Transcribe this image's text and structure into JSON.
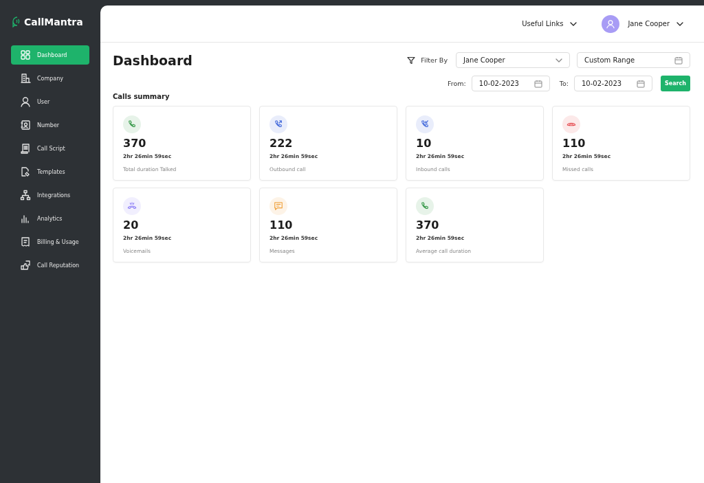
{
  "brand": {
    "name": "CallMantra"
  },
  "sidebar": {
    "items": [
      {
        "label": "Dashboard",
        "kind": "grid",
        "selected": true
      },
      {
        "label": "Company",
        "kind": "building",
        "selected": false
      },
      {
        "label": "User",
        "kind": "user",
        "selected": false
      },
      {
        "label": "Number",
        "kind": "contact",
        "selected": false
      },
      {
        "label": "Call Script",
        "kind": "scroll",
        "selected": false
      },
      {
        "label": "Templates",
        "kind": "file",
        "selected": false
      },
      {
        "label": "Integrations",
        "kind": "network",
        "selected": false
      },
      {
        "label": "Analytics",
        "kind": "bars",
        "selected": false
      },
      {
        "label": "Billing & Usage",
        "kind": "receipt",
        "selected": false
      },
      {
        "label": "Call Reputation",
        "kind": "thumbs",
        "selected": false
      }
    ]
  },
  "header": {
    "links": "Useful Links",
    "user": "Jane Cooper"
  },
  "page": {
    "title": "Dashboard",
    "filter_label": "Filter By",
    "filter_value": "Jane Cooper",
    "range_value": "Custom Range",
    "from_label": "From:",
    "from_value": "10-02-2023",
    "to_label": "To:",
    "to_value": "10-02-2023",
    "search_button": "Search"
  },
  "summary": {
    "title": "Calls summary",
    "cards": [
      {
        "kind": "phone",
        "color": "#3a9a4c",
        "value": "370",
        "duration": "2hr 26min 59sec",
        "label": "Total duration Talked"
      },
      {
        "kind": "outbound",
        "color": "#4a6fdc",
        "value": "222",
        "duration": "2hr 26min 59sec",
        "label": "Outbound call"
      },
      {
        "kind": "inbound",
        "color": "#4a6fdc",
        "value": "10",
        "duration": "2hr 26min 59sec",
        "label": "Inbound calls"
      },
      {
        "kind": "missed",
        "color": "#e5484d",
        "value": "110",
        "duration": "2hr 26min 59sec",
        "label": "Missed calls"
      },
      {
        "kind": "voicemail",
        "color": "#8b7cf6",
        "value": "20",
        "duration": "2hr 26min 59sec",
        "label": "Voicemails"
      },
      {
        "kind": "message",
        "color": "#f0a03a",
        "value": "110",
        "duration": "2hr 26min 59sec",
        "label": "Messages"
      },
      {
        "kind": "phone",
        "color": "#3a9a4c",
        "value": "370",
        "duration": "2hr 26min 59sec",
        "label": "Average call duration"
      }
    ]
  }
}
